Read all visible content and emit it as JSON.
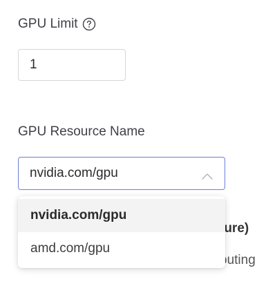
{
  "gpu_limit": {
    "label": "GPU Limit",
    "value": "1"
  },
  "resource_name": {
    "label": "GPU Resource Name",
    "selected": "nvidia.com/gpu",
    "options": [
      "nvidia.com/gpu",
      "amd.com/gpu"
    ]
  },
  "behind_text": {
    "line1": "ture)",
    "line2": "outing"
  },
  "colors": {
    "focus_border": "#6b7fd7",
    "selected_bg": "#f3f3f4"
  }
}
